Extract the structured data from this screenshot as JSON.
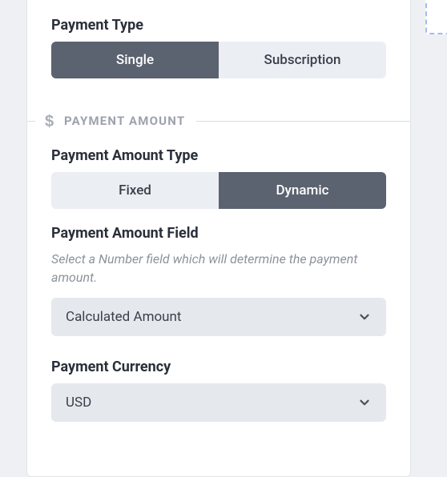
{
  "paymentType": {
    "label": "Payment Type",
    "options": [
      "Single",
      "Subscription"
    ],
    "selected": "Single"
  },
  "paymentAmountSection": {
    "title": "PAYMENT AMOUNT"
  },
  "paymentAmountType": {
    "label": "Payment Amount Type",
    "options": [
      "Fixed",
      "Dynamic"
    ],
    "selected": "Dynamic"
  },
  "paymentAmountField": {
    "label": "Payment Amount Field",
    "help": "Select a Number field which will determine the payment amount.",
    "value": "Calculated Amount"
  },
  "paymentCurrency": {
    "label": "Payment Currency",
    "value": "USD"
  }
}
